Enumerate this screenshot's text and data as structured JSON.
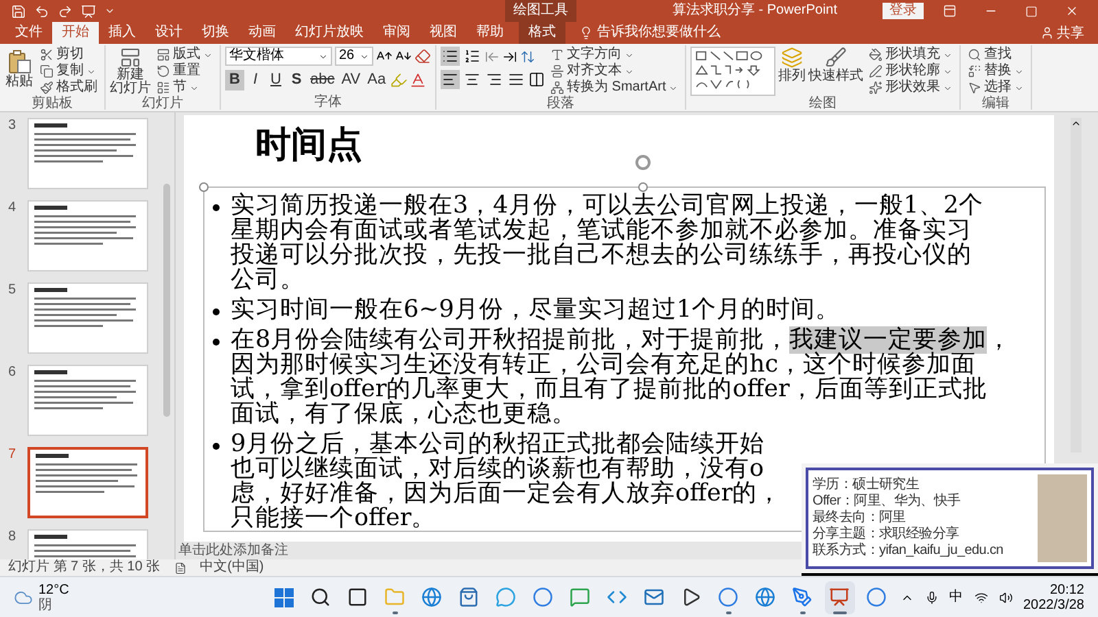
{
  "title_bar": {
    "contextual_label": "绘图工具",
    "title": "算法求职分享 - PowerPoint",
    "sign_in": "登录"
  },
  "tabs": [
    {
      "label": "文件",
      "kind": "normal",
      "selected": false
    },
    {
      "label": "开始",
      "kind": "normal",
      "selected": true
    },
    {
      "label": "插入",
      "kind": "normal",
      "selected": false
    },
    {
      "label": "设计",
      "kind": "normal",
      "selected": false
    },
    {
      "label": "切换",
      "kind": "normal",
      "selected": false
    },
    {
      "label": "动画",
      "kind": "normal",
      "selected": false
    },
    {
      "label": "幻灯片放映",
      "kind": "normal",
      "selected": false
    },
    {
      "label": "审阅",
      "kind": "normal",
      "selected": false
    },
    {
      "label": "视图",
      "kind": "normal",
      "selected": false
    },
    {
      "label": "帮助",
      "kind": "normal",
      "selected": false
    },
    {
      "label": "格式",
      "kind": "contextual",
      "selected": false
    }
  ],
  "tell_me": "告诉我你想要做什么",
  "share": "共享",
  "ribbon": {
    "clipboard": {
      "label": "剪贴板",
      "paste": "粘贴",
      "cut": "剪切",
      "copy": "复制",
      "format_painter": "格式刷"
    },
    "slides": {
      "label": "幻灯片",
      "new_slide": [
        "新建",
        "幻灯片"
      ],
      "layout": "版式",
      "reset": "重置",
      "section": "节"
    },
    "font": {
      "label": "字体",
      "name": "华文楷体",
      "size": "26",
      "styles": [
        {
          "label": "B",
          "kind": "bold",
          "on": true
        },
        {
          "label": "I",
          "kind": "italic",
          "on": false
        },
        {
          "label": "U",
          "kind": "underline",
          "on": false
        },
        {
          "label": "S",
          "kind": "shadow",
          "on": false
        },
        {
          "label": "abc",
          "kind": "strike",
          "on": false
        },
        {
          "label": "AV",
          "kind": "spacing",
          "on": false
        },
        {
          "label": "Aa",
          "kind": "case",
          "on": false
        }
      ]
    },
    "paragraph": {
      "label": "段落",
      "bullets_on": true,
      "numbering_on": false,
      "align": [
        {
          "kind": "left",
          "selected": true
        },
        {
          "kind": "center",
          "selected": false
        },
        {
          "kind": "right",
          "selected": false
        },
        {
          "kind": "justify",
          "selected": false
        }
      ],
      "text_direction": "文字方向",
      "align_text": "对齐文本",
      "smartart": "转换为 SmartArt"
    },
    "drawing": {
      "label": "绘图",
      "arrange": "排列",
      "quick_styles": "快速样式",
      "fill": "形状填充",
      "outline": "形状轮廓",
      "effects": "形状效果"
    },
    "editing": {
      "label": "编辑",
      "find": "查找",
      "replace": "替换",
      "select": "选择"
    }
  },
  "slides": [
    {
      "number": "3",
      "selected": false
    },
    {
      "number": "4",
      "selected": false
    },
    {
      "number": "5",
      "selected": false
    },
    {
      "number": "6",
      "selected": false
    },
    {
      "number": "7",
      "selected": true
    },
    {
      "number": "8",
      "selected": false
    }
  ],
  "slide": {
    "title": "时间点",
    "bullets": [
      {
        "lines": [
          [
            {
              "text": "实习简历投递一般在3，4月份，可以去公司官网上投递，一般1、2个",
              "highlighted": false
            }
          ],
          [
            {
              "text": "星期内会有面试或者笔试发起，笔试能不参加就不必参加。准备实习",
              "highlighted": false
            }
          ],
          [
            {
              "text": "投递可以分批次投，先投一批自己不想去的公司练练手，再投心仪的",
              "highlighted": false
            }
          ],
          [
            {
              "text": "公司。",
              "highlighted": false
            }
          ]
        ]
      },
      {
        "lines": [
          [
            {
              "text": "实习时间一般在6~9月份，尽量实习超过1个月的时间。",
              "highlighted": false
            }
          ]
        ]
      },
      {
        "lines": [
          [
            {
              "text": "在8月份会陆续有公司开秋招提前批，对于提前批，",
              "highlighted": false
            },
            {
              "text": "我建议一定要参加",
              "highlighted": true
            },
            {
              "text": "，",
              "highlighted": false
            }
          ],
          [
            {
              "text": "因为那时候实习生还没有转正，公司会有充足的hc，这个时候参加面",
              "highlighted": false
            }
          ],
          [
            {
              "text": "试，拿到offer的几率更大，而且有了提前批的offer，后面等到正式批",
              "highlighted": false
            }
          ],
          [
            {
              "text": "面试，有了保底，心态也更稳。",
              "highlighted": false
            }
          ]
        ]
      },
      {
        "lines": [
          [
            {
              "text": "9月份之后，基本公司的秋招正式批都会陆续开始",
              "highlighted": false
            }
          ],
          [
            {
              "text": "也可以继续面试，对后续的谈薪也有帮助，没有o",
              "highlighted": false
            }
          ],
          [
            {
              "text": "虑，好好准备，因为后面一定会有人放弃offer的，",
              "highlighted": false
            }
          ],
          [
            {
              "text": "只能接一个offer。",
              "highlighted": false
            }
          ]
        ]
      }
    ]
  },
  "notes_placeholder": "单击此处添加备注",
  "status_bar": {
    "slide_count": "幻灯片 第 7 张，共 10 张",
    "language": "中文(中国)"
  },
  "video_overlay": {
    "lines": [
      "学历：硕士研究生",
      "Offer：阿里、华为、快手",
      "最终去向：阿里",
      "分享主题：求职经验分享",
      "联系方式：yifan_kaifu_ju_edu.cn"
    ]
  },
  "taskbar": {
    "weather": {
      "temp": "12°C",
      "condition": "阴"
    },
    "apps": [
      {
        "kind": "start",
        "running": false,
        "selected": false
      },
      {
        "kind": "search",
        "running": false,
        "selected": false
      },
      {
        "kind": "taskview",
        "running": false,
        "selected": false
      },
      {
        "kind": "files",
        "running": true,
        "selected": false
      },
      {
        "kind": "browser",
        "running": false,
        "selected": false
      },
      {
        "kind": "store",
        "running": false,
        "selected": false
      },
      {
        "kind": "chat",
        "running": false,
        "selected": false
      },
      {
        "kind": "circle",
        "running": false,
        "selected": false
      },
      {
        "kind": "message",
        "running": false,
        "selected": false
      },
      {
        "kind": "code",
        "running": false,
        "selected": false
      },
      {
        "kind": "mail",
        "running": false,
        "selected": false
      },
      {
        "kind": "media",
        "running": false,
        "selected": false
      },
      {
        "kind": "circle",
        "running": true,
        "selected": false
      },
      {
        "kind": "browser",
        "running": false,
        "selected": false
      },
      {
        "kind": "pen",
        "running": true,
        "selected": false
      },
      {
        "kind": "slides",
        "running": true,
        "selected": true
      },
      {
        "kind": "circle",
        "running": false,
        "selected": false
      }
    ],
    "ime": "中",
    "time": "20:12",
    "date": "2022/3/28"
  }
}
